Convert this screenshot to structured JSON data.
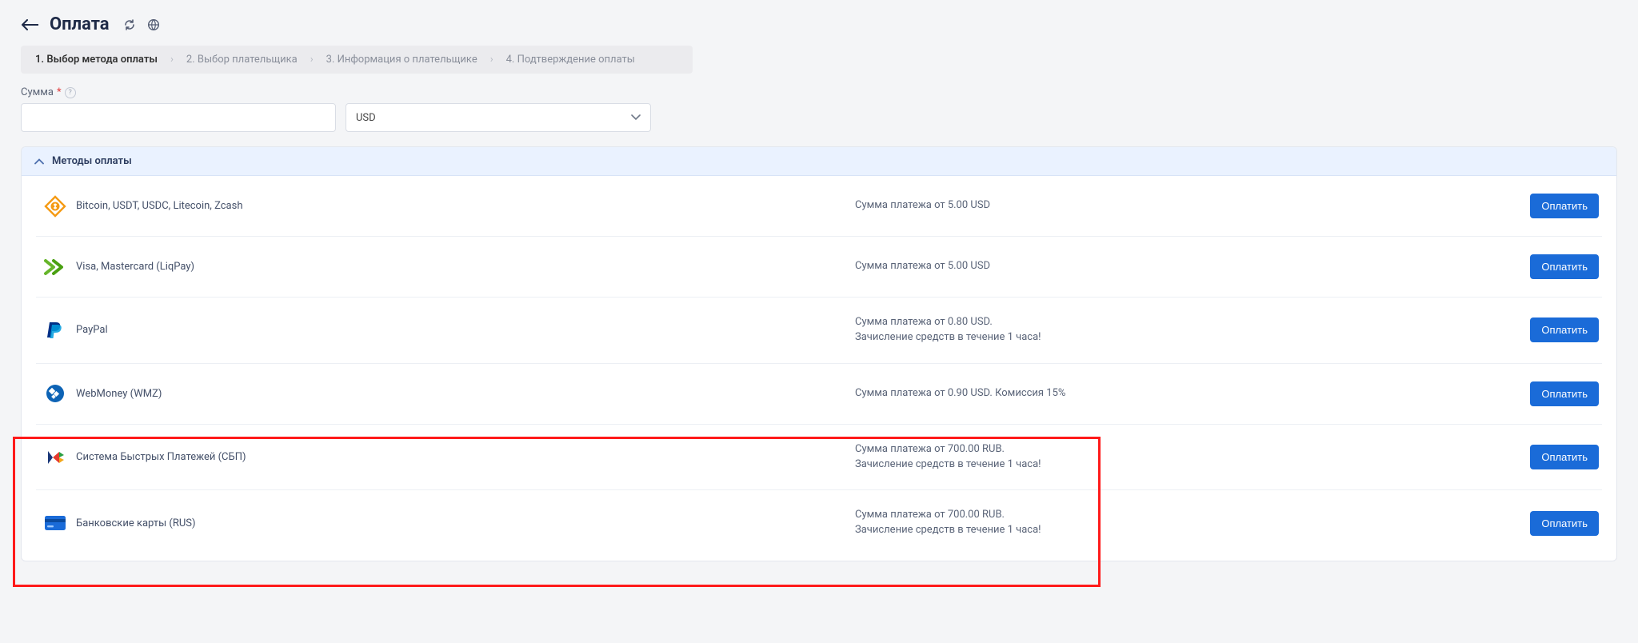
{
  "header": {
    "title": "Оплата"
  },
  "steps": [
    {
      "label": "1. Выбор метода оплаты",
      "active": true
    },
    {
      "label": "2. Выбор плательщика",
      "active": false
    },
    {
      "label": "3. Информация о плательщике",
      "active": false
    },
    {
      "label": "4. Подтверждение оплаты",
      "active": false
    }
  ],
  "amount": {
    "label": "Сумма",
    "currency": "USD",
    "value": ""
  },
  "panel": {
    "title": "Методы оплаты",
    "pay_button": "Оплатить"
  },
  "methods": [
    {
      "icon": "crypto-icon",
      "name": "Bitcoin, USDT, USDC, Litecoin, Zcash",
      "desc": "Сумма платежа от 5.00 USD"
    },
    {
      "icon": "card-liqpay-icon",
      "name": "Visa, Mastercard (LiqPay)",
      "desc": "Сумма платежа от 5.00 USD"
    },
    {
      "icon": "paypal-icon",
      "name": "PayPal",
      "desc": "Сумма платежа от 0.80 USD.\nЗачисление средств в течение 1 часа!"
    },
    {
      "icon": "webmoney-icon",
      "name": "WebMoney (WMZ)",
      "desc": "Сумма платежа от 0.90 USD. Комиссия 15%"
    },
    {
      "icon": "sbp-icon",
      "name": "Система Быстрых Платежей (СБП)",
      "desc": "Сумма платежа от 700.00 RUB.\nЗачисление средств в течение 1 часа!"
    },
    {
      "icon": "bankcard-rus-icon",
      "name": "Банковские карты (RUS)",
      "desc": "Сумма платежа от 700.00 RUB.\nЗачисление средств в течение 1 часа!"
    }
  ]
}
